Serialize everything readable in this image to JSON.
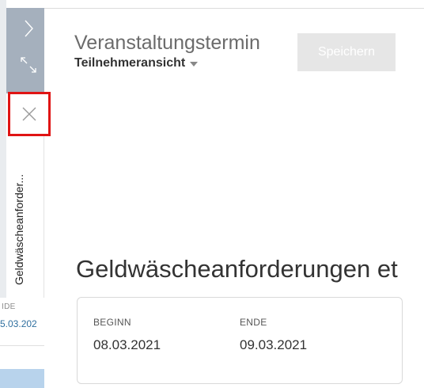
{
  "background_fragment": {
    "label": "IDE",
    "value": "5.03.202"
  },
  "panel": {
    "vertical_title": "Geldwäscheanforder..."
  },
  "header": {
    "title": "Veranstaltungstermin",
    "view_selector": "Teilnehmeransicht",
    "save_label": "Speichern"
  },
  "record": {
    "heading": "Geldwäscheanforderungen et",
    "fields": [
      {
        "label": "BEGINN",
        "value": "08.03.2021"
      },
      {
        "label": "ENDE",
        "value": "09.03.2021"
      }
    ]
  },
  "colors": {
    "rail": "#a5b0bd",
    "highlight": "#e01414",
    "save_disabled": "#e6e6e6"
  },
  "icons": [
    "chevron-right-icon",
    "expand-icon",
    "close-icon",
    "caret-down-icon"
  ]
}
